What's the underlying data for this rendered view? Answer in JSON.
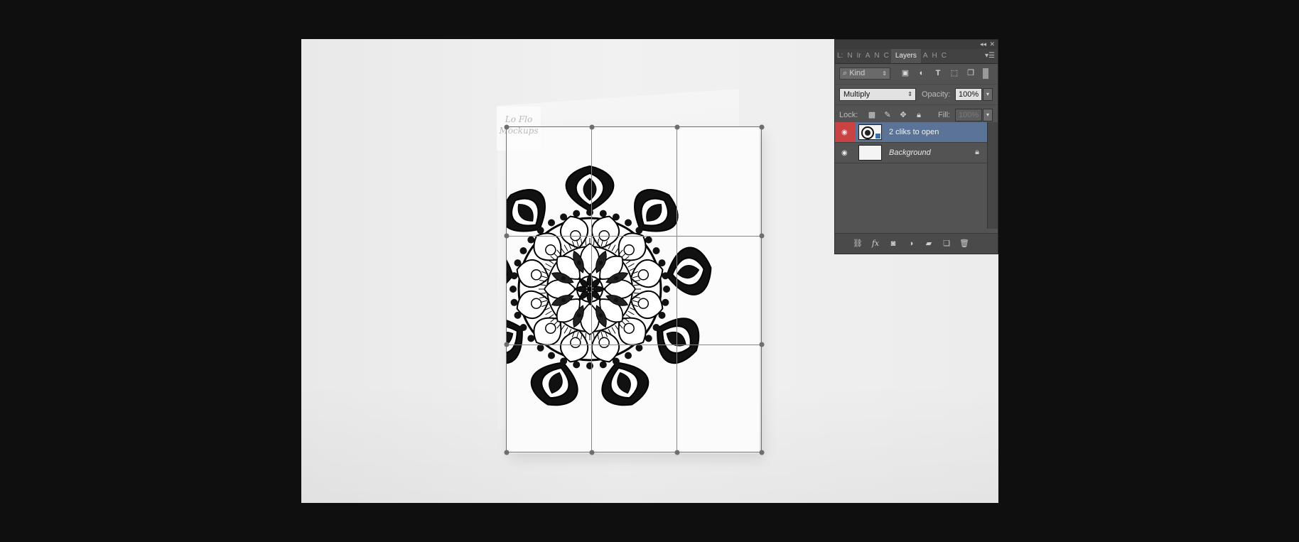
{
  "canvas": {
    "watermark_text": "Lo Flo Mockups"
  },
  "layers_panel": {
    "collapse_glyph": "◂◂",
    "close_glyph": "✕",
    "menu_glyph": "▾☰",
    "tabs": [
      {
        "label": "L:"
      },
      {
        "label": "N"
      },
      {
        "label": "Ir"
      },
      {
        "label": "A"
      },
      {
        "label": "N"
      },
      {
        "label": "C"
      },
      {
        "label": "Layers"
      },
      {
        "label": "A"
      },
      {
        "label": "H"
      },
      {
        "label": "C"
      }
    ],
    "filter": {
      "kind_label": "Kind",
      "icons": [
        "image-filter-icon",
        "adjustment-filter-icon",
        "type-filter-icon",
        "shape-filter-icon",
        "smart-object-filter-icon"
      ]
    },
    "blend_mode": "Multiply",
    "opacity_label": "Opacity:",
    "opacity_value": "100%",
    "lock_label": "Lock:",
    "fill_label": "Fill:",
    "fill_value": "100%",
    "layers": [
      {
        "name": "2 cliks to open",
        "selected": true,
        "visible": true,
        "locked": false
      },
      {
        "name": "Background",
        "selected": false,
        "visible": true,
        "locked": true
      }
    ],
    "footer_icons": [
      "link-layers-icon",
      "fx-icon",
      "add-mask-icon",
      "adjustment-layer-icon",
      "group-folder-icon",
      "new-layer-icon",
      "trash-icon"
    ],
    "colors": {
      "panel_bg": "#535353",
      "selected_layer": "#5b7396",
      "visibility_highlight": "#c94343"
    }
  }
}
